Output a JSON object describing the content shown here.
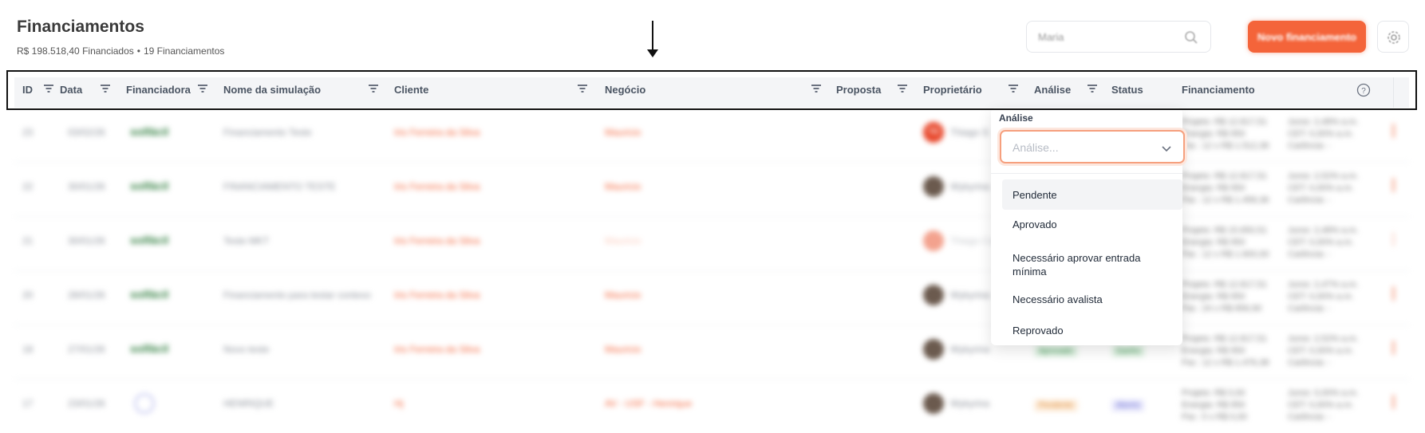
{
  "page": {
    "title": "Financiamentos",
    "summary_amount": "R$ 198.518,40 Financiados",
    "summary_sep": "•",
    "summary_count": "19 Financiamentos"
  },
  "search": {
    "value": "Maria",
    "icon": "search-icon"
  },
  "actions": {
    "new_label": "Novo financiamento",
    "settings_icon": "gear-icon"
  },
  "table": {
    "columns": {
      "id": "ID",
      "data": "Data",
      "financiadora": "Financiadora",
      "nome": "Nome da simulação",
      "cliente": "Cliente",
      "negocio": "Negócio",
      "proposta": "Proposta",
      "proprietario": "Proprietário",
      "analise": "Análise",
      "status": "Status",
      "financiamento": "Financiamento"
    },
    "help_icon": "help-circle-icon",
    "rows": [
      {
        "id": "23",
        "date": "03/02/26",
        "lender": "solfácil",
        "name": "Financiamento Teste",
        "client": "Iris Ferreira da Silva",
        "deal": "Mauricio",
        "owner": "Thiago S",
        "fin1": "Projeto: R$ 12.817,51",
        "fin2": "Energia: R$ 950",
        "fin3": "Par.: 12 x R$ 1.512,36",
        "rate1": "Juros: 2,48% a.m.",
        "rate2": "CET: 0,00% a.m.",
        "rate3": "Carência: -"
      },
      {
        "id": "22",
        "date": "30/01/26",
        "lender": "solfácil",
        "name": "FINANCIAMENTO TESTE",
        "client": "Iris Ferreira da Silva",
        "deal": "Mauricio",
        "owner": "Wykyrina",
        "fin1": "Projeto: R$ 12.817,51",
        "fin2": "Energia: R$ 950",
        "fin3": "Par.: 12 x R$ 1.458,36",
        "rate1": "Juros: 2,52% a.m.",
        "rate2": "CET: 0,00% a.m.",
        "rate3": "Carência: -"
      },
      {
        "id": "21",
        "date": "30/01/26",
        "lender": "solfácil",
        "name": "Teste MKT",
        "client": "Iris Ferreira da Silva",
        "deal": "Mauricio",
        "owner": "Thiago Ca",
        "fin1": "Projeto: R$ 15.650,51",
        "fin2": "Energia: R$ 950",
        "fin3": "Par.: 12 x R$ 1.600,00",
        "rate1": "Juros: 2,48% a.m.",
        "rate2": "CET: 0,00% a.m.",
        "rate3": "Carência: -"
      },
      {
        "id": "20",
        "date": "28/01/26",
        "lender": "solfácil",
        "name": "Financiamento para testar contexo",
        "client": "Iris Ferreira da Silva",
        "deal": "Mauricio",
        "owner": "Wykyrina",
        "fin1": "Projeto: R$ 12.817,51",
        "fin2": "Energia: R$ 950",
        "fin3": "Par.: 24 x R$ 856,90",
        "rate1": "Juros: 2,47% a.m.",
        "rate2": "CET: 0,00% a.m.",
        "rate3": "Carência: -"
      },
      {
        "id": "18",
        "date": "27/01/26",
        "lender": "solfácil",
        "name": "Novo teste",
        "client": "Iris Ferreira da Silva",
        "deal": "Mauricio",
        "owner": "Wykyrina",
        "analysis": "Aprovado",
        "status": "Ganho",
        "fin1": "Projeto: R$ 12.817,51",
        "fin2": "Energia: R$ 950",
        "fin3": "Par.: 12 x R$ 1.476,38",
        "rate1": "Juros: 2,52% a.m.",
        "rate2": "CET: 0,00% a.m.",
        "rate3": "Carência: -"
      },
      {
        "id": "17",
        "date": "23/01/26",
        "lender": "",
        "name": "HENRIQUE",
        "client": "Hj",
        "deal": "AV - USF - Henrique",
        "owner": "Wykyrina",
        "analysis": "Pendente",
        "status": "Aberto",
        "fin1": "Projeto: R$ 0,00",
        "fin2": "Energia: R$ 950",
        "fin3": "Par.: 0 x R$ 0,00",
        "rate1": "Juros: 0,00% a.m.",
        "rate2": "CET: 0,00% a.m.",
        "rate3": "Carência: -"
      }
    ]
  },
  "dropdown": {
    "label": "Análise",
    "placeholder": "Análise...",
    "options": [
      "Pendente",
      "Aprovado",
      "Necessário aprovar entrada mínima",
      "Necessário avalista",
      "Reprovado"
    ]
  },
  "colors": {
    "accent": "#f4643a",
    "header_bg": "#f4f5f7",
    "link": "#f4643a"
  }
}
